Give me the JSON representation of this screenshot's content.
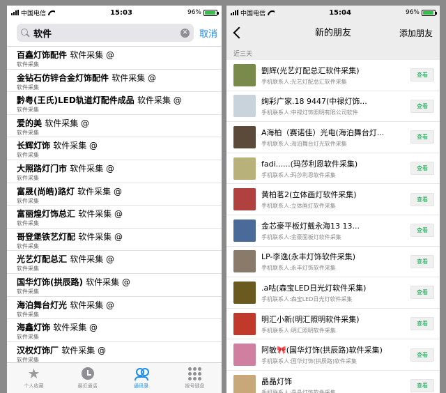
{
  "left": {
    "status": {
      "carrier": "中国电信",
      "time": "15:03",
      "battery": "96%",
      "battery_level": 0.96
    },
    "search": {
      "query": "软件",
      "cancel_label": "取消"
    },
    "results": [
      {
        "name": "百鑫灯饰配件",
        "suffix": "软件采集 @",
        "sub": "软件采集"
      },
      {
        "name": "金钻石仿锌合金灯饰配件",
        "suffix": "软件采集 @",
        "sub": "软件采集"
      },
      {
        "name": "黔粤(王氏)LED轨道灯配件成品",
        "suffix": "软件采集 @",
        "sub": "软件采集"
      },
      {
        "name": "爱的美",
        "suffix": "软件采集 @",
        "sub": "软件采集"
      },
      {
        "name": "长辉灯饰",
        "suffix": "软件采集 @",
        "sub": "软件采集"
      },
      {
        "name": "大照路灯门市",
        "suffix": "软件采集 @",
        "sub": "软件采集"
      },
      {
        "name": "富晟(尚皓)路灯",
        "suffix": "软件采集 @",
        "sub": "软件采集"
      },
      {
        "name": "富丽煌灯饰总汇",
        "suffix": "软件采集 @",
        "sub": "软件采集"
      },
      {
        "name": "哥登堡铁艺灯配",
        "suffix": "软件采集 @",
        "sub": "软件采集"
      },
      {
        "name": "光艺灯配总汇",
        "suffix": "软件采集 @",
        "sub": "软件采集"
      },
      {
        "name": "国华灯饰(拱辰路)",
        "suffix": "软件采集 @",
        "sub": "软件采集"
      },
      {
        "name": "海泊舞台灯光",
        "suffix": "软件采集 @",
        "sub": "软件采集"
      },
      {
        "name": "海鑫灯饰",
        "suffix": "软件采集 @",
        "sub": "软件采集"
      },
      {
        "name": "汉权灯饰厂",
        "suffix": "软件采集 @",
        "sub": "软件采集"
      }
    ],
    "tabs": [
      {
        "label": "个人收藏",
        "icon": "star-icon"
      },
      {
        "label": "最近通话",
        "icon": "clock-icon"
      },
      {
        "label": "通讯录",
        "icon": "contacts-icon"
      },
      {
        "label": "拨号键盘",
        "icon": "keypad-icon"
      }
    ],
    "accent": "#1a8bf0"
  },
  "right": {
    "status": {
      "carrier": "中国电信",
      "time": "15:04",
      "battery": "96%",
      "battery_level": 0.96
    },
    "nav": {
      "title": "新的朋友",
      "action": "添加朋友"
    },
    "section": "近三天",
    "view_label": "查看",
    "friends": [
      {
        "name": "劉辉(光艺灯配总汇软件采集)",
        "sub": "手机联系人:光艺灯配总汇软件采集",
        "color": "#7a8a4a"
      },
      {
        "name": "绚彩广家.18        9447(中禄灯饰...",
        "sub": "手机联系人:中禄灯饰照明有限公司软件",
        "color": "#c9d3dc"
      },
      {
        "name": "A海柏（赛诺佳）光电(海泊舞台灯...",
        "sub": "手机联系人:海泊舞台灯光软件采集",
        "color": "#5b4a3a"
      },
      {
        "name": "fadi......(玛莎利恩软件采集)",
        "sub": "手机联系人:玛莎利恩软件采集",
        "color": "#b8b27a"
      },
      {
        "name": "黄柏茗2(立体画灯软件采集)",
        "sub": "手机联系人:立体画灯软件采集",
        "color": "#b0413e"
      },
      {
        "name": "金芯豪平板灯戴永海13        13...",
        "sub": "手机联系人:金豪面板灯软件采集",
        "color": "#4a6a9a"
      },
      {
        "name": "LP-李逸(永丰灯饰软件采集)",
        "sub": "手机联系人:永丰灯饰软件采集",
        "color": "#8a7a6a"
      },
      {
        "name": ".a咕(森宝LED日光灯软件采集)",
        "sub": "手机联系人:森宝LED日光灯软件采集",
        "color": "#6a5a20"
      },
      {
        "name": "明汇小新(明汇照明软件采集)",
        "sub": "手机联系人:明汇照明软件采集",
        "color": "#c0392b"
      },
      {
        "name": "阿敏🎀(国华灯饰(拱辰路)软件采集)",
        "sub": "手机联系人:国华灯饰(拱辰路)软件采集",
        "color": "#d07fa0"
      },
      {
        "name": "晶晶灯饰",
        "sub": "手机联系人:晶晶灯饰软件采集",
        "color": "#c8a878"
      }
    ],
    "button_text_color": "#07a64a"
  }
}
